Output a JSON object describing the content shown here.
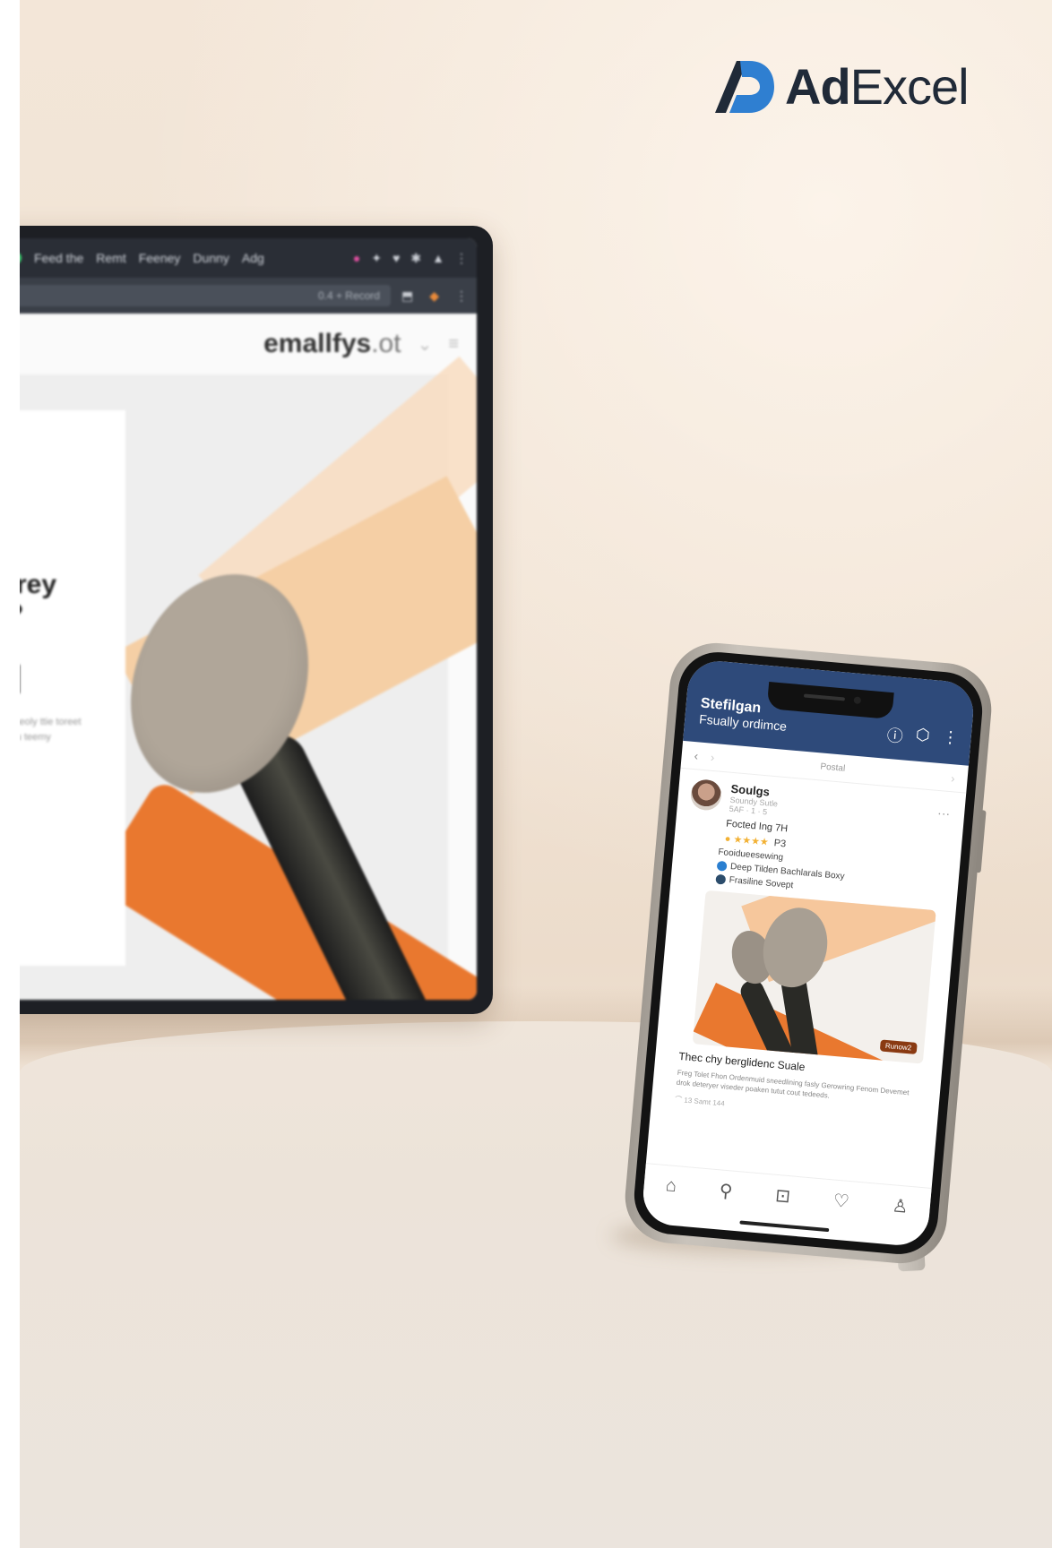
{
  "brand": {
    "name_bold": "Ad",
    "name_regular": "Excel",
    "mark_color": "#2f7fd1",
    "text_color": "#202a38"
  },
  "monitor": {
    "tabs": [
      "Feed the",
      "Remt",
      "Feeney",
      "Dunny",
      "Adg"
    ],
    "url_text": "0.4 + Record",
    "site_brand_bold": "emallfys",
    "site_brand_light": ".ot",
    "hero_text_lines": [
      "frey",
      "?"
    ],
    "hero_small": "Sneoly ttie toreet oru teemy",
    "colors": {
      "orange": "#e9782f",
      "peach": "#f5cfa5",
      "disc": "#b0a699"
    }
  },
  "phone": {
    "header_title": "Stefilgan",
    "header_subtitle": "Fsually ordimce",
    "header_icons": [
      "help-icon",
      "notification-icon",
      "more-icon"
    ],
    "nav_label": "Postal",
    "post": {
      "name": "Soulgs",
      "sub1": "Soundy Sutle",
      "sub2": "5AF · 1 · 5",
      "line": "Focted Ing 7H",
      "rating_count": "P3",
      "caption_prefix": "Fooidueesewing",
      "tag1": "Deep Tilden Bachlarals Boxy",
      "tag2": "Frasiline Sovept",
      "image_badge": "Runow2",
      "title": "Thec chy berglidenc Suale",
      "body": "Freg Tolet Fhon Ordenmuid sneedlining fasly Gerowring Fenom Devemet drok deteryer viseder poaken tutut cout tedeeds.",
      "actions": "⌒  13  Samt  144"
    },
    "tab_icons": [
      "home-icon",
      "search-icon",
      "create-icon",
      "heart-icon",
      "profile-icon"
    ],
    "header_color": "#2e4a7a"
  }
}
